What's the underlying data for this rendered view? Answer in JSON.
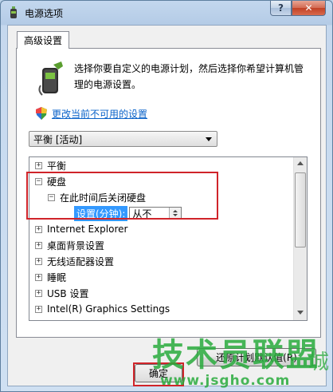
{
  "window": {
    "title": "电源选项",
    "help_glyph": "?",
    "close_glyph": "✕"
  },
  "tab": {
    "label": "高级设置"
  },
  "description": "选择你要自定义的电源计划，然后选择你希望计算机管理的电源设置。",
  "link": {
    "label": "更改当前不可用的设置"
  },
  "plan_select": {
    "value": "平衡 [活动]"
  },
  "tree": {
    "items": [
      {
        "label": "平衡",
        "expander": "+"
      },
      {
        "label": "硬盘",
        "expander": "−"
      },
      {
        "label": "在此时间后关闭硬盘",
        "expander": "−"
      },
      {
        "label": "Internet Explorer",
        "expander": "+"
      },
      {
        "label": "桌面背景设置",
        "expander": "+"
      },
      {
        "label": "无线适配器设置",
        "expander": "+"
      },
      {
        "label": "睡眠",
        "expander": "+"
      },
      {
        "label": "USB 设置",
        "expander": "+"
      },
      {
        "label": "Intel(R) Graphics Settings",
        "expander": "+"
      }
    ],
    "setting": {
      "label": "设置(分钟):",
      "value": "从不"
    }
  },
  "buttons": {
    "restore": "还原计划默认值(R)",
    "ok": "确定"
  },
  "watermark": {
    "brand": "技术员联盟",
    "url": "www.jsgho.com",
    "suffix": "城"
  }
}
